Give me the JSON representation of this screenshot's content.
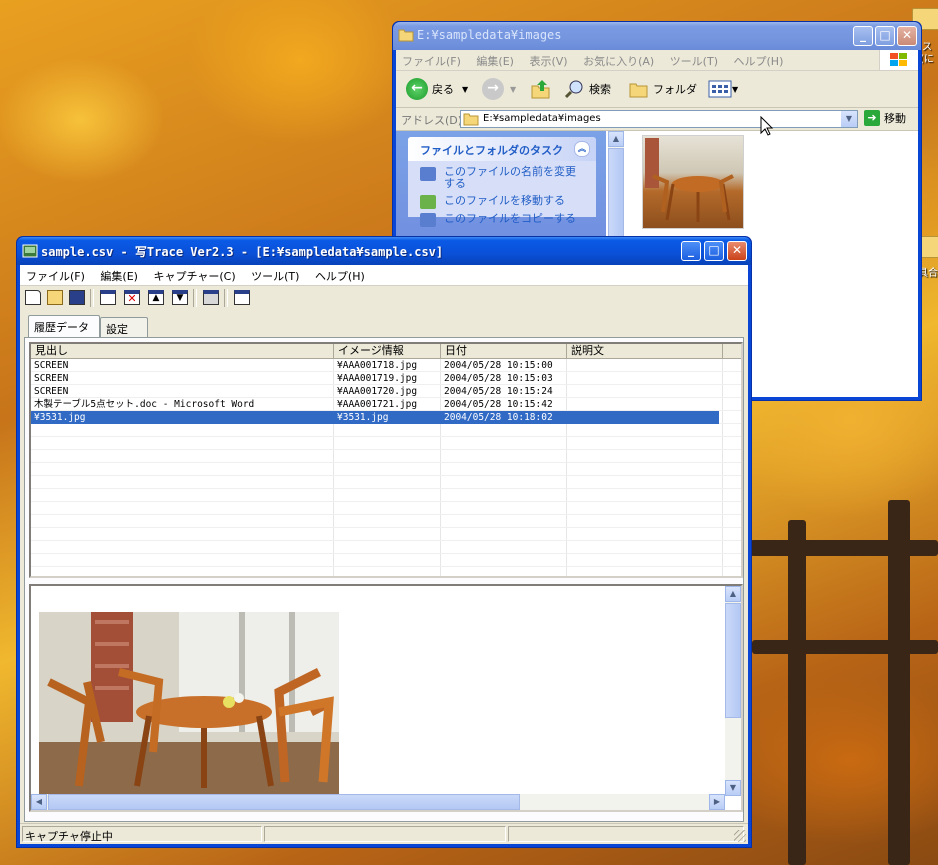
{
  "explorer": {
    "title": "E:¥sampledata¥images",
    "menu": [
      "ファイル(F)",
      "編集(E)",
      "表示(V)",
      "お気に入り(A)",
      "ツール(T)",
      "ヘルプ(H)"
    ],
    "toolbar": {
      "back": "戻る",
      "search": "検索",
      "folders": "フォルダ"
    },
    "address_label": "アドレス(D)",
    "address": "E:¥sampledata¥images",
    "go_label": "移動",
    "tasks_title": "ファイルとフォルダのタスク",
    "tasks": [
      "このファイルの名前を変更する",
      "このファイルを移動する",
      "このファイルをコピーする"
    ]
  },
  "photo": {
    "title": "sample.csv - 写Trace Ver2.3 - [E:¥sampledata¥sample.csv]",
    "menu": [
      "ファイル(F)",
      "編集(E)",
      "キャプチャー(C)",
      "ツール(T)",
      "ヘルプ(H)"
    ],
    "tabs": [
      "履歴データ",
      "設定"
    ],
    "columns": [
      "見出し",
      "イメージ情報",
      "日付",
      "説明文"
    ],
    "rows": [
      {
        "title": "SCREEN",
        "image": "¥AAA001718.jpg",
        "date": "2004/05/28 10:15:00",
        "desc": ""
      },
      {
        "title": "SCREEN",
        "image": "¥AAA001719.jpg",
        "date": "2004/05/28 10:15:03",
        "desc": ""
      },
      {
        "title": "SCREEN",
        "image": "¥AAA001720.jpg",
        "date": "2004/05/28 10:15:24",
        "desc": ""
      },
      {
        "title": "木製テーブル5点セット.doc - Microsoft Word",
        "image": "¥AAA001721.jpg",
        "date": "2004/05/28 10:15:42",
        "desc": ""
      },
      {
        "title": "¥3531.jpg",
        "image": "¥3531.jpg",
        "date": "2004/05/28 10:18:02",
        "desc": ""
      }
    ],
    "selected_row": 4,
    "status": "キャプチャ停止中"
  },
  "desktop": {
    "icon_labels": [
      "ス",
      "(に",
      "具合"
    ]
  },
  "colors": {
    "xp_blue": "#0a46d6",
    "selection": "#316ac5",
    "task_link": "#215dc6"
  }
}
